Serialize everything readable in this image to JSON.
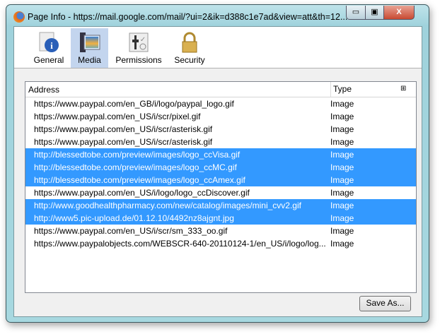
{
  "window": {
    "title": "Page Info - https://mail.google.com/mail/?ui=2&ik=d388c1e7ad&view=att&th=12...",
    "minimize": "▭",
    "maximize": "▣",
    "close": "X"
  },
  "tabs": [
    {
      "label": "General",
      "icon": "info-icon"
    },
    {
      "label": "Media",
      "icon": "media-icon",
      "selected": true
    },
    {
      "label": "Permissions",
      "icon": "permissions-icon"
    },
    {
      "label": "Security",
      "icon": "lock-icon"
    }
  ],
  "table": {
    "headers": {
      "address": "Address",
      "type": "Type"
    },
    "rows": [
      {
        "address": "https://www.paypal.com/en_GB/i/logo/paypal_logo.gif",
        "type": "Image",
        "selected": false
      },
      {
        "address": "https://www.paypal.com/en_US/i/scr/pixel.gif",
        "type": "Image",
        "selected": false
      },
      {
        "address": "https://www.paypal.com/en_US/i/scr/asterisk.gif",
        "type": "Image",
        "selected": false
      },
      {
        "address": "https://www.paypal.com/en_US/i/scr/asterisk.gif",
        "type": "Image",
        "selected": false
      },
      {
        "address": "http://blessedtobe.com/preview/images/logo_ccVisa.gif",
        "type": "Image",
        "selected": true
      },
      {
        "address": "http://blessedtobe.com/preview/images/logo_ccMC.gif",
        "type": "Image",
        "selected": true
      },
      {
        "address": "http://blessedtobe.com/preview/images/logo_ccAmex.gif",
        "type": "Image",
        "selected": true
      },
      {
        "address": "https://www.paypal.com/en_US/i/logo/logo_ccDiscover.gif",
        "type": "Image",
        "selected": false
      },
      {
        "address": "http://www.goodhealthpharmacy.com/new/catalog/images/mini_cvv2.gif",
        "type": "Image",
        "selected": true
      },
      {
        "address": "http://www5.pic-upload.de/01.12.10/4492nz8ajgnt.jpg",
        "type": "Image",
        "selected": true
      },
      {
        "address": "https://www.paypal.com/en_US/i/scr/sm_333_oo.gif",
        "type": "Image",
        "selected": false
      },
      {
        "address": "https://www.paypalobjects.com/WEBSCR-640-20110124-1/en_US/i/logo/log...",
        "type": "Image",
        "selected": false
      }
    ]
  },
  "save_label": "Save As..."
}
